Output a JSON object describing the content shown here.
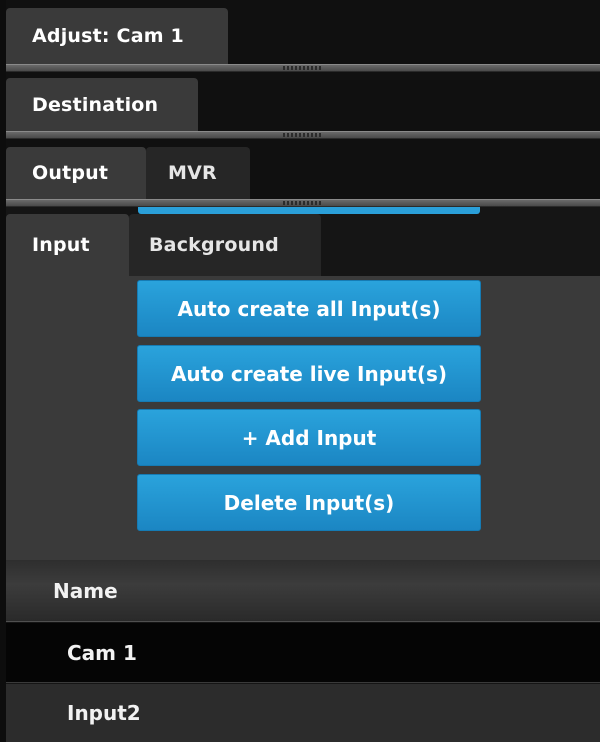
{
  "panels": {
    "adjust": {
      "tab_label": "Adjust: Cam 1"
    },
    "destination": {
      "tab_label": "Destination"
    },
    "output": {
      "tabs": [
        "Output",
        "MVR"
      ]
    },
    "input": {
      "tabs": [
        "Input",
        "Background"
      ]
    }
  },
  "actions": {
    "auto_create_all": "Auto create all Input(s)",
    "auto_create_live": "Auto create live Input(s)",
    "add_input": "+ Add Input",
    "delete_inputs": "Delete Input(s)"
  },
  "table": {
    "header": "Name",
    "rows": [
      "Cam 1",
      "Input2"
    ]
  },
  "colors": {
    "accent": "#1f93d0",
    "panel_bg": "#3a3a3a",
    "dark_bg": "#101010"
  }
}
